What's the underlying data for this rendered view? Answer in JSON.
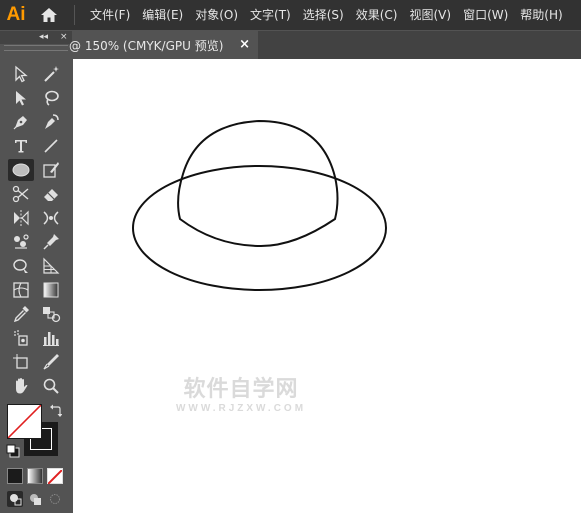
{
  "app": {
    "logo": "Ai"
  },
  "menu": {
    "items": [
      {
        "label": "文件(F)"
      },
      {
        "label": "编辑(E)"
      },
      {
        "label": "对象(O)"
      },
      {
        "label": "文字(T)"
      },
      {
        "label": "选择(S)"
      },
      {
        "label": "效果(C)"
      },
      {
        "label": "视图(V)"
      },
      {
        "label": "窗口(W)"
      },
      {
        "label": "帮助(H)"
      }
    ]
  },
  "toolpanel": {
    "header": {
      "collapse": "◂◂",
      "close": "×"
    },
    "tools": [
      {
        "icon": "selection-tool-icon"
      },
      {
        "icon": "magic-wand-tool-icon"
      },
      {
        "icon": "direct-selection-tool-icon"
      },
      {
        "icon": "lasso-tool-icon"
      },
      {
        "icon": "pen-tool-icon"
      },
      {
        "icon": "curvature-tool-icon"
      },
      {
        "icon": "type-tool-icon",
        "glyph": "T"
      },
      {
        "icon": "line-segment-tool-icon"
      },
      {
        "icon": "ellipse-tool-icon",
        "active": true
      },
      {
        "icon": "paintbrush-tool-icon"
      },
      {
        "icon": "shaper-tool-icon"
      },
      {
        "icon": "eraser-tool-icon"
      },
      {
        "icon": "rotate-tool-icon"
      },
      {
        "icon": "scale-tool-icon"
      },
      {
        "icon": "width-tool-icon"
      },
      {
        "icon": "free-transform-tool-icon"
      },
      {
        "icon": "shape-builder-tool-icon"
      },
      {
        "icon": "puppet-warp-tool-icon"
      },
      {
        "icon": "perspective-grid-tool-icon"
      },
      {
        "icon": "perspective-selection-tool-icon"
      },
      {
        "icon": "mesh-tool-icon"
      },
      {
        "icon": "gradient-tool-icon"
      },
      {
        "icon": "eyedropper-tool-icon"
      },
      {
        "icon": "blend-tool-icon"
      },
      {
        "icon": "symbol-sprayer-tool-icon"
      },
      {
        "icon": "column-graph-tool-icon"
      },
      {
        "icon": "artboard-tool-icon"
      },
      {
        "icon": "slice-tool-icon"
      },
      {
        "icon": "hand-tool-icon"
      },
      {
        "icon": "zoom-tool-icon"
      }
    ],
    "fill_color": "#ffffff",
    "stroke_color": "#000000",
    "color_modes": [
      "color",
      "gradient",
      "none"
    ],
    "screen_modes": [
      "normal-screen-mode",
      "draw-behind-mode",
      "draw-inside-mode"
    ]
  },
  "document": {
    "tab_title": "@ 150% (CMYK/GPU 预览)",
    "tab_close": "×"
  },
  "canvas": {
    "background": "#ffffff",
    "artwork": [
      "ellipse-brim",
      "dome-crown"
    ],
    "stroke_color": "#000000"
  },
  "watermark": {
    "title": "软件自学网",
    "url": "WWW.RJZXW.COM"
  }
}
